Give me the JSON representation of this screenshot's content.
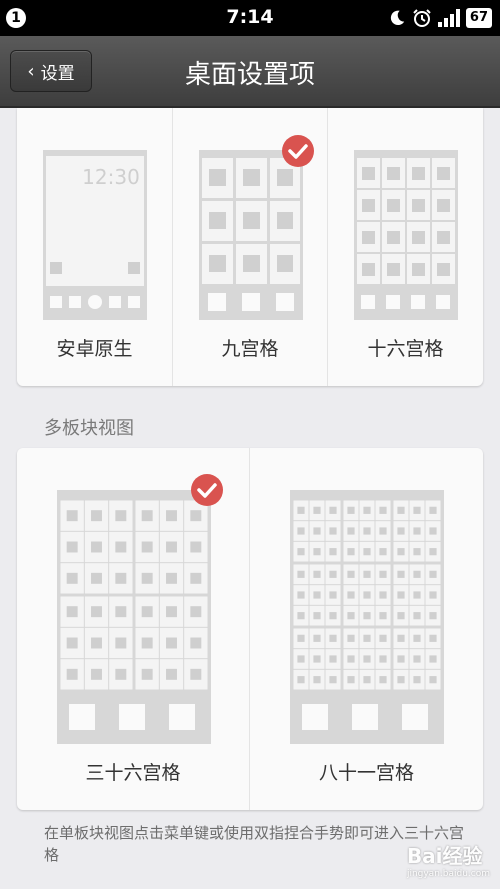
{
  "status_bar": {
    "notification_count": "1",
    "time": "7:14",
    "battery": "67",
    "icons": [
      "moon-icon",
      "alarm-icon",
      "signal-icon",
      "battery-icon"
    ]
  },
  "header": {
    "back_label": "设置",
    "title": "桌面设置项"
  },
  "layouts_single": [
    {
      "label": "安卓原生",
      "selected": false,
      "preview_clock": "12:30"
    },
    {
      "label": "九宫格",
      "selected": true
    },
    {
      "label": "十六宫格",
      "selected": false
    }
  ],
  "section_title": "多板块视图",
  "layouts_multi": [
    {
      "label": "三十六宫格",
      "selected": true
    },
    {
      "label": "八十一宫格",
      "selected": false
    }
  ],
  "footer_note": "在单板块视图点击菜单键或使用双指捏合手势即可进入三十六宫格",
  "watermark": {
    "brand": "Bai经验",
    "url": "jingyan.baidu.com"
  },
  "colors": {
    "check": "#d9534f",
    "accent_dark": "#3e3e3e"
  }
}
